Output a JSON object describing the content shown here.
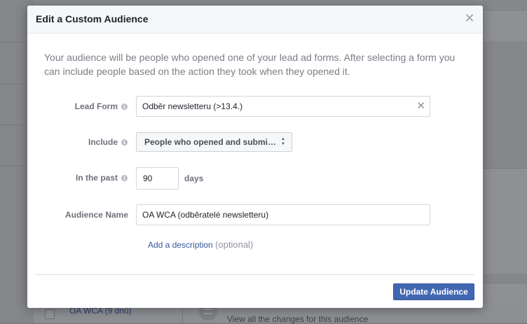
{
  "background": {
    "audience_row_name": "OA WCA (9 dnů)",
    "changes_link": "View all the changes for this audience"
  },
  "modal": {
    "title": "Edit a Custom Audience",
    "close_icon": "close-icon",
    "intro": "Your audience will be people who opened one of your lead ad forms. After selecting a form you can include people based on the action they took when they opened it.",
    "lead_form": {
      "label": "Lead Form",
      "value": "Odběr newsletteru (>13.4.)"
    },
    "include": {
      "label": "Include",
      "selected": "People who opened and submi…"
    },
    "in_the_past": {
      "label": "In the past",
      "value": "90",
      "unit": "days"
    },
    "audience_name": {
      "label": "Audience Name",
      "value": "OA WCA (odběratelé newsletteru)"
    },
    "add_description": "Add a description",
    "optional": "(optional)",
    "update_button": "Update Audience"
  },
  "colors": {
    "primary_button": "#4267b2",
    "link": "#365899"
  }
}
